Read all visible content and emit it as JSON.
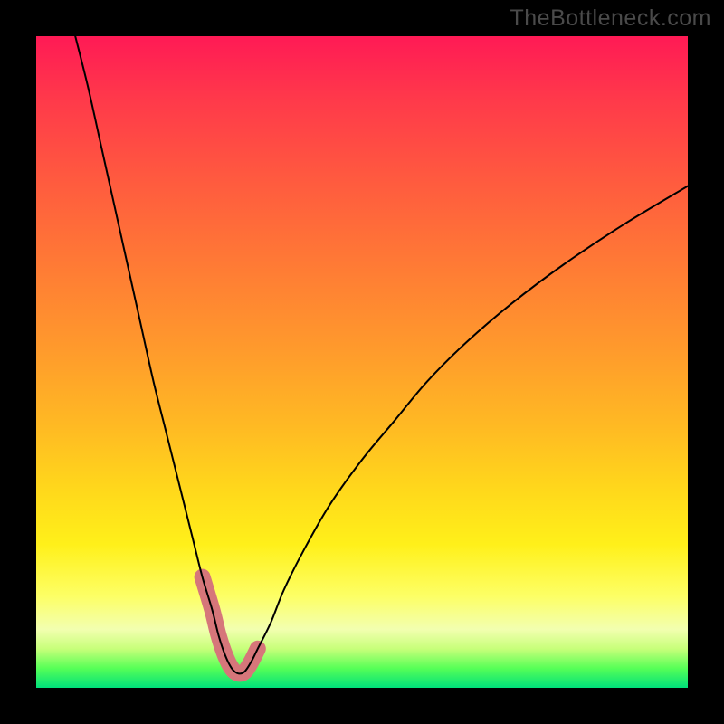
{
  "watermark": "TheBottleneck.com",
  "chart_data": {
    "type": "line",
    "title": "",
    "xlabel": "",
    "ylabel": "",
    "xlim": [
      0,
      100
    ],
    "ylim": [
      0,
      100
    ],
    "grid": false,
    "legend": false,
    "annotations": [],
    "gradient_bands": [
      {
        "y": 100,
        "color": "#ff1a55"
      },
      {
        "y": 50,
        "color": "#ff9a2c"
      },
      {
        "y": 22,
        "color": "#fff01a"
      },
      {
        "y": 6,
        "color": "#c8ff7a"
      },
      {
        "y": 0,
        "color": "#00e07a"
      }
    ],
    "series": [
      {
        "name": "bottleneck-curve",
        "color": "#000000",
        "stroke_width": 2,
        "x": [
          6,
          8,
          10,
          12,
          14,
          16,
          18,
          20,
          22,
          24,
          25.5,
          27,
          28,
          29,
          30,
          31,
          32,
          33,
          34,
          36,
          38,
          41,
          45,
          50,
          55,
          60,
          66,
          73,
          81,
          90,
          100
        ],
        "y": [
          100,
          92,
          83,
          74,
          65,
          56,
          47,
          39,
          31,
          23,
          17,
          12,
          8,
          5,
          3,
          2.2,
          2.5,
          4,
          6,
          10,
          15,
          21,
          28,
          35,
          41,
          47,
          53,
          59,
          65,
          71,
          77
        ]
      },
      {
        "name": "highlighted-min-band",
        "color": "#d6767a",
        "stroke_width": 18,
        "x": [
          25.5,
          27,
          28,
          29,
          30,
          31,
          32,
          33,
          34
        ],
        "y": [
          17,
          12,
          8,
          5,
          3,
          2.2,
          2.5,
          4,
          6
        ]
      }
    ],
    "min_point": {
      "x": 31,
      "y": 2.2
    }
  }
}
